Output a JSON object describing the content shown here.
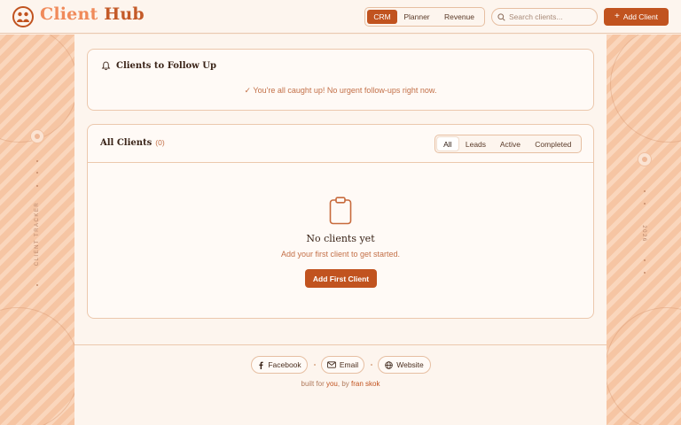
{
  "header": {
    "brand_word1": "Client",
    "brand_word2": "Hub",
    "nav": [
      {
        "label": "CRM",
        "active": true
      },
      {
        "label": "Planner",
        "active": false
      },
      {
        "label": "Revenue",
        "active": false
      }
    ],
    "search_placeholder": "Search clients...",
    "add_button_label": "Add Client"
  },
  "sidebars": {
    "left_text": "CLIENT TRACKER",
    "right_text": "2026"
  },
  "follow_up": {
    "title": "Clients to Follow Up",
    "message": "✓ You're all caught up! No urgent follow-ups right now."
  },
  "clients": {
    "title": "All Clients",
    "count": "(0)",
    "filters": [
      {
        "label": "All",
        "active": true
      },
      {
        "label": "Leads",
        "active": false
      },
      {
        "label": "Active",
        "active": false
      },
      {
        "label": "Completed",
        "active": false
      }
    ],
    "empty_title": "No clients yet",
    "empty_subtitle": "Add your first client to get started.",
    "empty_button": "Add First Client"
  },
  "footer": {
    "links": [
      {
        "label": "Facebook",
        "icon": "facebook-icon"
      },
      {
        "label": "Email",
        "icon": "mail-icon"
      },
      {
        "label": "Website",
        "icon": "globe-icon"
      }
    ],
    "credit_prefix": "built for",
    "credit_you": "you",
    "credit_by": ", by",
    "credit_author": "fran skok"
  },
  "colors": {
    "accent": "#c1531f",
    "brand_light": "#f08a5a",
    "side_panel": "#f6c5a3"
  }
}
